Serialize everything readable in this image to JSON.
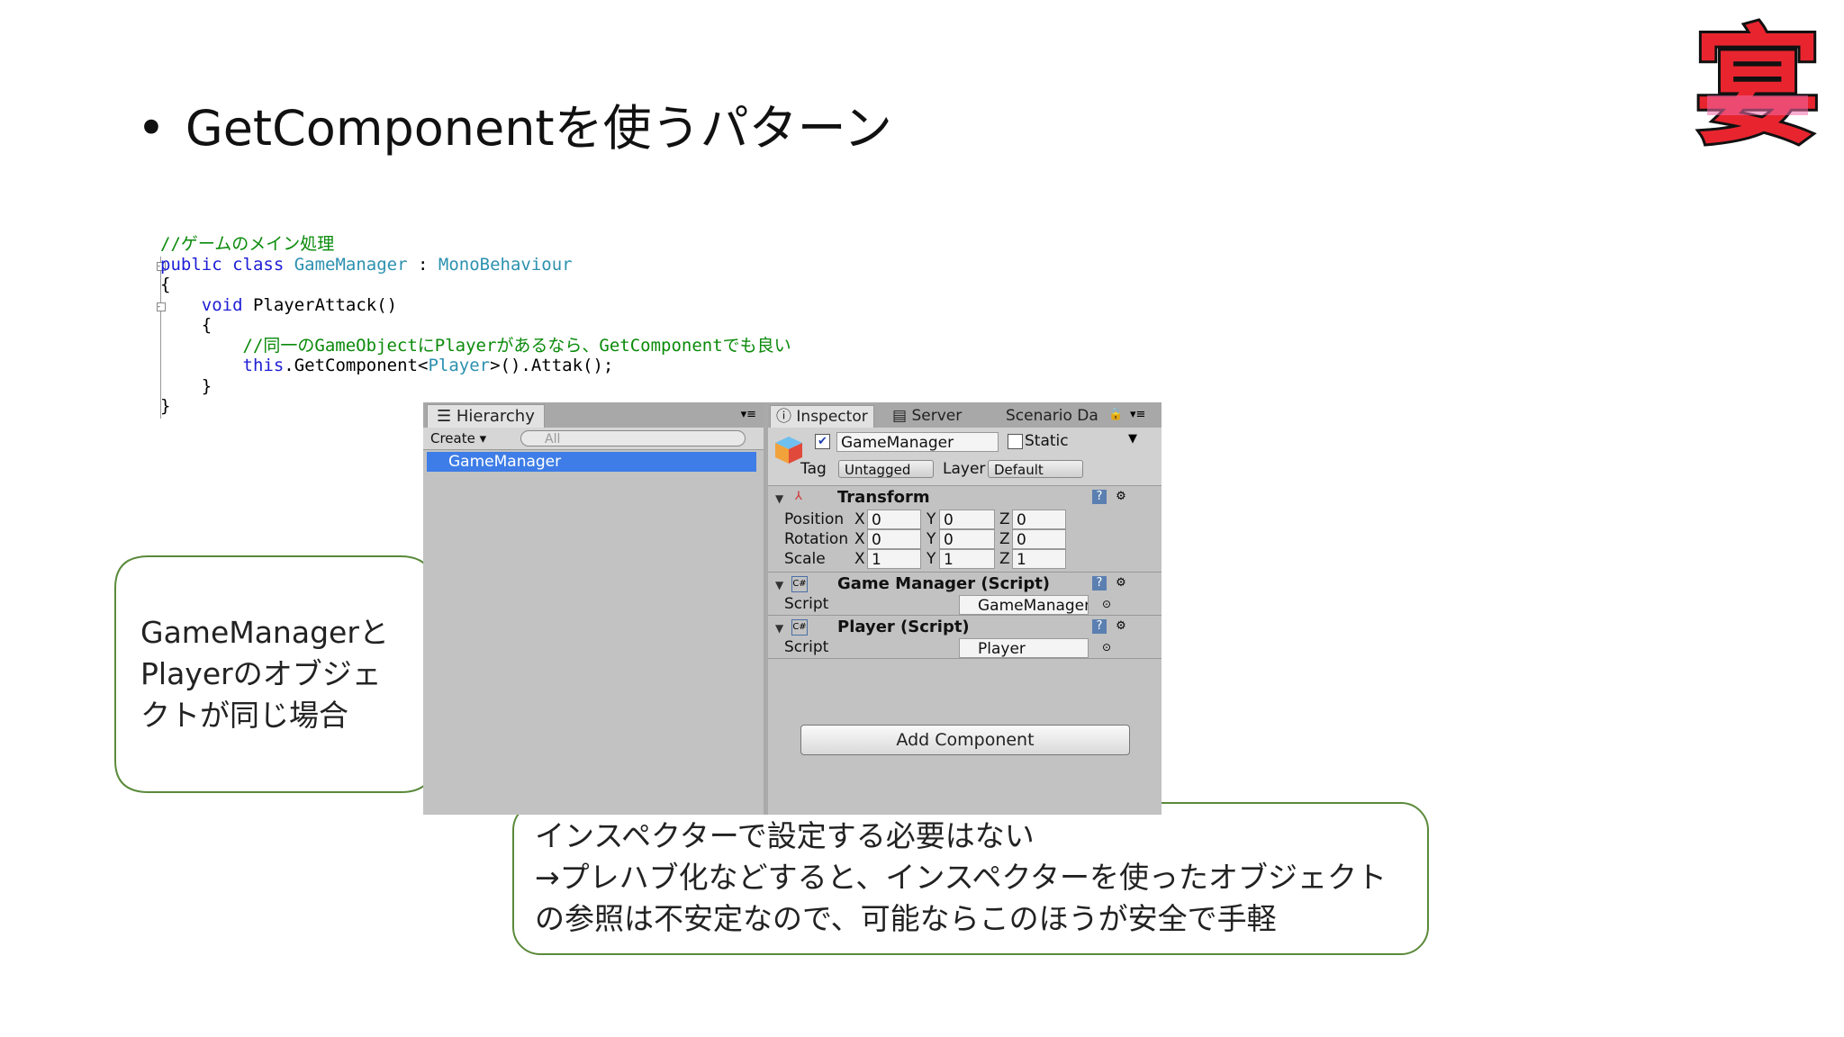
{
  "slide": {
    "bullet": "•",
    "title": "GetComponentを使うパターン"
  },
  "logo": {
    "label": "宴"
  },
  "code": {
    "lines": [
      {
        "comment": "//ゲームのメイン処理"
      },
      {
        "kw": "public class ",
        "type": "GameManager",
        "plain": " : ",
        "type2": "MonoBehaviour"
      },
      {
        "plain": "{"
      },
      {
        "indent": "    ",
        "kw": "void ",
        "plain": "PlayerAttack()"
      },
      {
        "indent": "    ",
        "plain": "{"
      },
      {
        "indent": "        ",
        "comment": "//同一のGameObjectにPlayerがあるなら、GetComponentでも良い"
      },
      {
        "indent": "        ",
        "kw": "this",
        "plain": ".GetComponent<",
        "type": "Player",
        "plain2": ">().Attak();"
      },
      {
        "indent": "    ",
        "plain": "}"
      },
      {
        "plain": "}"
      }
    ]
  },
  "hierarchy": {
    "tab_label": "Hierarchy",
    "create_label": "Create ▾",
    "search_placeholder": "All",
    "selected_item": "GameManager"
  },
  "inspector": {
    "tabs": [
      "Inspector",
      "Server",
      "Scenario Da"
    ],
    "object_name": "GameManager",
    "static_label": "Static",
    "tag_label": "Tag",
    "tag_value": "Untagged",
    "layer_label": "Layer",
    "layer_value": "Default",
    "transform": {
      "title": "Transform",
      "rows": [
        {
          "label": "Position",
          "x": "0",
          "y": "0",
          "z": "0"
        },
        {
          "label": "Rotation",
          "x": "0",
          "y": "0",
          "z": "0"
        },
        {
          "label": "Scale",
          "x": "1",
          "y": "1",
          "z": "1"
        }
      ],
      "axis": {
        "x": "X",
        "y": "Y",
        "z": "Z"
      }
    },
    "components": [
      {
        "title": "Game Manager (Script)",
        "script_label": "Script",
        "script_value": "GameManager"
      },
      {
        "title": "Player (Script)",
        "script_label": "Script",
        "script_value": "Player"
      }
    ],
    "add_component": "Add Component"
  },
  "callouts": {
    "left": [
      "GameManagerと",
      "Playerのオブジェ",
      "クトが同じ場合"
    ],
    "bottom": [
      "インスペクターで設定する必要はない",
      "→プレハブ化などすると、インスペクターを使ったオブジェクト",
      "の参照は不安定なので、可能ならこのほうが安全で手軽"
    ]
  },
  "colors": {
    "callout_border": "#5a8a3a",
    "selection": "#3e7de7",
    "logo_red": "#e8252f",
    "logo_pink": "#f06aa8"
  }
}
